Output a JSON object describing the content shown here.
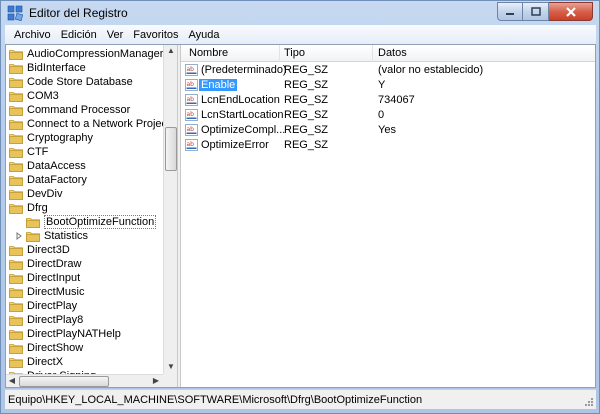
{
  "window": {
    "title": "Editor del Registro"
  },
  "menu": [
    "Archivo",
    "Edición",
    "Ver",
    "Favoritos",
    "Ayuda"
  ],
  "tree": [
    {
      "label": "AudioCompressionManager",
      "indent": 0
    },
    {
      "label": "BidInterface",
      "indent": 0
    },
    {
      "label": "Code Store Database",
      "indent": 0
    },
    {
      "label": "COM3",
      "indent": 0
    },
    {
      "label": "Command Processor",
      "indent": 0
    },
    {
      "label": "Connect to a Network Projector",
      "indent": 0
    },
    {
      "label": "Cryptography",
      "indent": 0
    },
    {
      "label": "CTF",
      "indent": 0
    },
    {
      "label": "DataAccess",
      "indent": 0
    },
    {
      "label": "DataFactory",
      "indent": 0
    },
    {
      "label": "DevDiv",
      "indent": 0
    },
    {
      "label": "Dfrg",
      "indent": 0
    },
    {
      "label": "BootOptimizeFunction",
      "indent": 1,
      "selected": true
    },
    {
      "label": "Statistics",
      "indent": 1,
      "expander": true
    },
    {
      "label": "Direct3D",
      "indent": 0
    },
    {
      "label": "DirectDraw",
      "indent": 0
    },
    {
      "label": "DirectInput",
      "indent": 0
    },
    {
      "label": "DirectMusic",
      "indent": 0
    },
    {
      "label": "DirectPlay",
      "indent": 0
    },
    {
      "label": "DirectPlay8",
      "indent": 0
    },
    {
      "label": "DirectPlayNATHelp",
      "indent": 0
    },
    {
      "label": "DirectShow",
      "indent": 0
    },
    {
      "label": "DirectX",
      "indent": 0
    },
    {
      "label": "Driver Signing",
      "indent": 0
    }
  ],
  "list": {
    "columns": [
      "Nombre",
      "Tipo",
      "Datos"
    ],
    "rows": [
      {
        "name": "(Predeterminado)",
        "type": "REG_SZ",
        "data": "(valor no establecido)"
      },
      {
        "name": "Enable",
        "type": "REG_SZ",
        "data": "Y",
        "selected": true
      },
      {
        "name": "LcnEndLocation",
        "type": "REG_SZ",
        "data": "734067"
      },
      {
        "name": "LcnStartLocation",
        "type": "REG_SZ",
        "data": "0"
      },
      {
        "name": "OptimizeCompl...",
        "type": "REG_SZ",
        "data": "Yes"
      },
      {
        "name": "OptimizeError",
        "type": "REG_SZ",
        "data": ""
      }
    ]
  },
  "status": {
    "path": "Equipo\\HKEY_LOCAL_MACHINE\\SOFTWARE\\Microsoft\\Dfrg\\BootOptimizeFunction"
  },
  "icons": {
    "folder": "folder-icon",
    "string_value": "ab-string-value-icon"
  },
  "colors": {
    "selection": "#3399ff",
    "folder": "#e8c25a",
    "close_button": "#c7402a"
  }
}
